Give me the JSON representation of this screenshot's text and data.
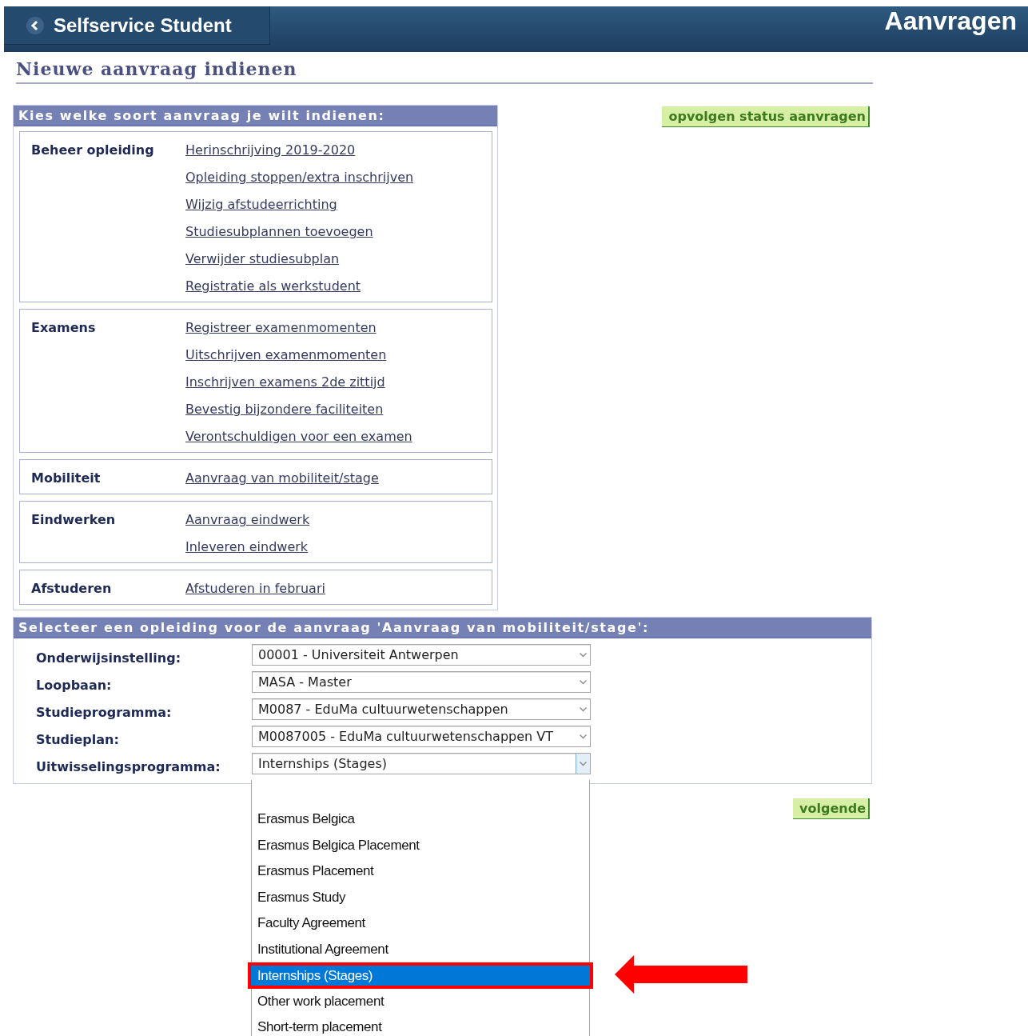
{
  "header": {
    "app_title": "Selfservice Student",
    "page_title": "Aanvragen"
  },
  "heading": "Nieuwe aanvraag indienen",
  "request_panel": {
    "title": "Kies welke soort aanvraag je wilt indienen:",
    "groups": [
      {
        "name": "Beheer opleiding",
        "links": [
          "Herinschrijving 2019-2020",
          "Opleiding stoppen/extra inschrijven",
          "Wijzig afstudeerrichting",
          "Studiesubplannen toevoegen",
          "Verwijder studiesubplan",
          "Registratie als werkstudent"
        ]
      },
      {
        "name": "Examens",
        "links": [
          "Registreer examenmomenten",
          "Uitschrijven examenmomenten",
          "Inschrijven examens 2de zittijd",
          "Bevestig bijzondere faciliteiten",
          "Verontschuldigen voor een examen"
        ]
      },
      {
        "name": "Mobiliteit",
        "links": [
          "Aanvraag van mobiliteit/stage"
        ]
      },
      {
        "name": "Eindwerken",
        "links": [
          "Aanvraag eindwerk",
          "Inleveren eindwerk"
        ]
      },
      {
        "name": "Afstuderen",
        "links": [
          "Afstuderen in februari"
        ]
      }
    ]
  },
  "status_button": "opvolgen status aanvragen",
  "program_panel": {
    "title": "Selecteer een opleiding voor de aanvraag 'Aanvraag van mobiliteit/stage':",
    "fields": [
      {
        "label": "Onderwijsinstelling:",
        "value": "00001 - Universiteit Antwerpen",
        "open": false
      },
      {
        "label": "Loopbaan:",
        "value": "MASA - Master",
        "open": false
      },
      {
        "label": "Studieprogramma:",
        "value": "M0087 - EduMa cultuurwetenschappen",
        "open": false
      },
      {
        "label": "Studieplan:",
        "value": "M0087005 - EduMa cultuurwetenschappen VT",
        "open": false
      },
      {
        "label": "Uitwisselingsprogramma:",
        "value": "Internships (Stages)",
        "open": true
      }
    ]
  },
  "next_button": "volgende",
  "dropdown": {
    "options": [
      {
        "label": "Erasmus Belgica",
        "selected": false
      },
      {
        "label": "Erasmus Belgica Placement",
        "selected": false
      },
      {
        "label": "Erasmus Placement",
        "selected": false
      },
      {
        "label": "Erasmus Study",
        "selected": false
      },
      {
        "label": "Faculty Agreement",
        "selected": false
      },
      {
        "label": "Institutional Agreement",
        "selected": false
      },
      {
        "label": "Internships (Stages)",
        "selected": true
      },
      {
        "label": "Other work placement",
        "selected": false
      },
      {
        "label": "Short-term placement",
        "selected": false
      }
    ]
  }
}
